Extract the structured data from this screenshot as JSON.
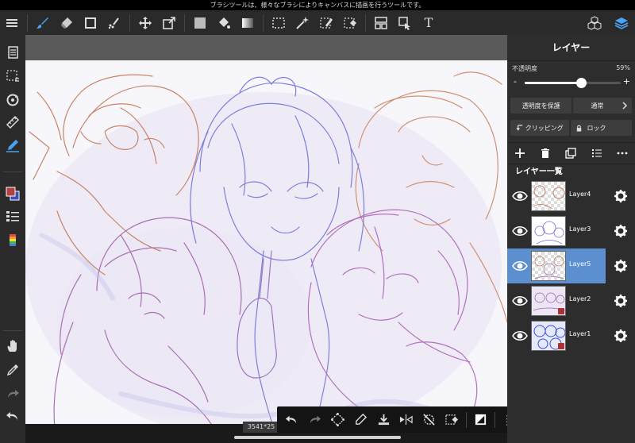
{
  "tip_bar": {
    "text": "ブラシツールは、様々なブラシによりキャンバスに描画を行うツールです。"
  },
  "toolbar": {
    "left_tools": [
      {
        "name": "menu-icon"
      },
      {
        "name": "brush-icon"
      },
      {
        "name": "eraser-icon"
      },
      {
        "name": "shape-icon"
      },
      {
        "name": "dot-brush-icon"
      },
      {
        "name": "move-icon"
      },
      {
        "name": "transform-icon"
      },
      {
        "name": "fill-color-icon"
      },
      {
        "name": "bucket-icon"
      },
      {
        "name": "gradient-icon"
      },
      {
        "name": "select-rect-icon"
      },
      {
        "name": "magic-wand-icon"
      },
      {
        "name": "select-pen-icon"
      },
      {
        "name": "select-eraser-icon"
      },
      {
        "name": "frame-icon"
      },
      {
        "name": "operation-icon"
      },
      {
        "name": "text-icon"
      }
    ],
    "right_tools": [
      {
        "name": "materials-icon"
      },
      {
        "name": "layers-icon"
      }
    ],
    "text_tool_label": "T"
  },
  "sidebar": {
    "tools": [
      "pages-icon",
      "selection-icon",
      "rotate-icon",
      "ruler-icon",
      "pen-stabilizer-icon",
      "color-icon",
      "palette-icon",
      "colorbar-icon",
      "hand-icon",
      "eyedropper-icon",
      "redo-icon",
      "undo-icon"
    ]
  },
  "canvas": {
    "size_label": "3541*25"
  },
  "bottom_tools": [
    "undo-icon",
    "redo-icon",
    "transform-icon",
    "pen-icon",
    "download-icon",
    "flip-icon",
    "no-snap-icon",
    "select-erase-icon",
    "filter-icon",
    "grip-icon"
  ],
  "layer_panel": {
    "title": "レイヤー",
    "opacity_label": "不透明度",
    "opacity_value": "59%",
    "opacity": 0.59,
    "slider_minus": "-",
    "slider_plus": "+",
    "protect_alpha_label": "透明度を保護",
    "blend_mode_label": "通常",
    "clipping_label": "クリッピング",
    "lock_label": "ロック",
    "actions": [
      "add-layer-icon",
      "delete-layer-icon",
      "duplicate-layer-icon",
      "layer-list-icon",
      "more-icon"
    ],
    "list_title": "レイヤー一覧",
    "layers": [
      {
        "name": "Layer4",
        "visible": true,
        "selected": false,
        "thumb": "check"
      },
      {
        "name": "Layer3",
        "visible": true,
        "selected": false,
        "thumb": "white"
      },
      {
        "name": "Layer5",
        "visible": true,
        "selected": true,
        "thumb": "check"
      },
      {
        "name": "Layer2",
        "visible": true,
        "selected": false,
        "thumb": "white",
        "clip": true
      },
      {
        "name": "Layer1",
        "visible": true,
        "selected": false,
        "thumb": "blue",
        "clip": true
      }
    ]
  },
  "colors": {
    "accent_selected": "#5b8fd0",
    "primary_color": "#b0413e",
    "secondary_color": "#3a4fb8",
    "sketch_red": "#c0704e",
    "sketch_blue": "#6a6ad8",
    "sketch_purple": "#a45ab4"
  }
}
